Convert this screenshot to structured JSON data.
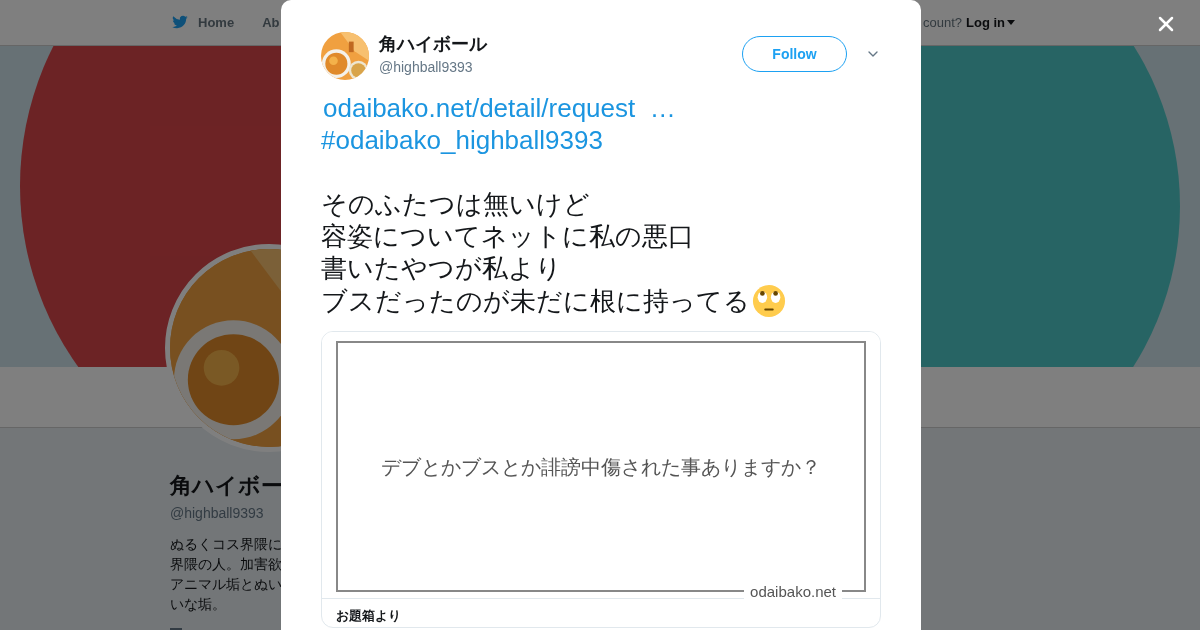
{
  "nav": {
    "items": [
      {
        "label": "Home"
      },
      {
        "label": "Ab"
      }
    ],
    "account_prompt": "count?",
    "login": "Log in"
  },
  "profile": {
    "name": "角ハイボー",
    "handle": "@highball9393",
    "bio": [
      "ぬるくコス界隈に",
      "界隈の人。加害欲",
      "アニマル垢とぬい",
      "いな垢。"
    ]
  },
  "modal": {
    "author": {
      "name": "角ハイボール",
      "handle": "@highball9393"
    },
    "follow_button": "Follow",
    "tweet": {
      "link": "odaibako.net/detail/request  …",
      "hashtag": "#odaibako_highball9393",
      "lines": [
        "そのふたつは無いけど",
        "容姿についてネットに私の悪口",
        "書いたやつが私より",
        "ブスだったのが未だに根に持ってる"
      ]
    },
    "card": {
      "question": "デブとかブスとか誹謗中傷された事ありますか？",
      "site": "odaibako.net",
      "title": "お題箱より"
    }
  }
}
